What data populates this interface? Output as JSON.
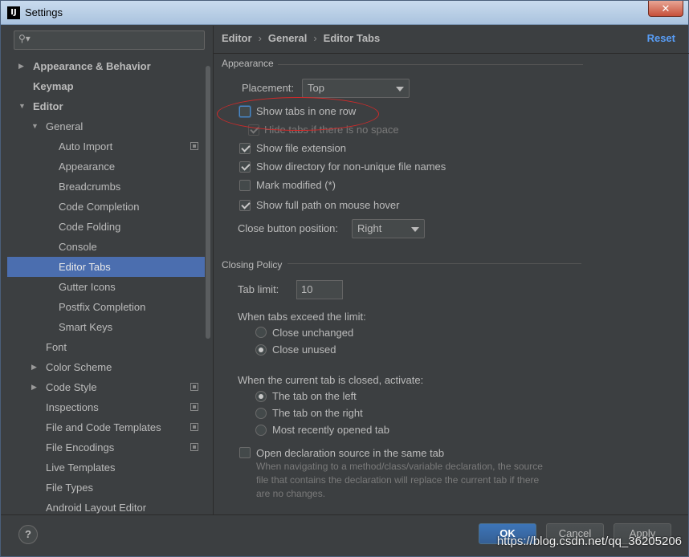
{
  "window": {
    "title": "Settings",
    "close_label": "✕"
  },
  "sidebar": {
    "search": {
      "placeholder": "",
      "icon": "search-icon"
    },
    "items": [
      {
        "label": "Appearance & Behavior",
        "level": 0,
        "bold": true,
        "arrow": "▶"
      },
      {
        "label": "Keymap",
        "level": 0,
        "bold": true,
        "arrow": ""
      },
      {
        "label": "Editor",
        "level": 0,
        "bold": true,
        "arrow": "▼"
      },
      {
        "label": "General",
        "level": 1,
        "bold": false,
        "arrow": "▼"
      },
      {
        "label": "Auto Import",
        "level": 2,
        "bold": false,
        "arrow": "",
        "project_icon": true
      },
      {
        "label": "Appearance",
        "level": 2,
        "bold": false,
        "arrow": ""
      },
      {
        "label": "Breadcrumbs",
        "level": 2,
        "bold": false,
        "arrow": ""
      },
      {
        "label": "Code Completion",
        "level": 2,
        "bold": false,
        "arrow": ""
      },
      {
        "label": "Code Folding",
        "level": 2,
        "bold": false,
        "arrow": ""
      },
      {
        "label": "Console",
        "level": 2,
        "bold": false,
        "arrow": ""
      },
      {
        "label": "Editor Tabs",
        "level": 2,
        "bold": false,
        "arrow": "",
        "selected": true
      },
      {
        "label": "Gutter Icons",
        "level": 2,
        "bold": false,
        "arrow": ""
      },
      {
        "label": "Postfix Completion",
        "level": 2,
        "bold": false,
        "arrow": ""
      },
      {
        "label": "Smart Keys",
        "level": 2,
        "bold": false,
        "arrow": ""
      },
      {
        "label": "Font",
        "level": 1,
        "bold": false,
        "arrow": ""
      },
      {
        "label": "Color Scheme",
        "level": 1,
        "bold": false,
        "arrow": "▶"
      },
      {
        "label": "Code Style",
        "level": 1,
        "bold": false,
        "arrow": "▶",
        "project_icon": true
      },
      {
        "label": "Inspections",
        "level": 1,
        "bold": false,
        "arrow": "",
        "project_icon": true
      },
      {
        "label": "File and Code Templates",
        "level": 1,
        "bold": false,
        "arrow": "",
        "project_icon": true
      },
      {
        "label": "File Encodings",
        "level": 1,
        "bold": false,
        "arrow": "",
        "project_icon": true
      },
      {
        "label": "Live Templates",
        "level": 1,
        "bold": false,
        "arrow": ""
      },
      {
        "label": "File Types",
        "level": 1,
        "bold": false,
        "arrow": ""
      },
      {
        "label": "Android Layout Editor",
        "level": 1,
        "bold": false,
        "arrow": ""
      }
    ]
  },
  "breadcrumb": {
    "part1": "Editor",
    "part2": "General",
    "part3": "Editor Tabs",
    "sep": "›"
  },
  "reset_label": "Reset",
  "appearance": {
    "title": "Appearance",
    "placement_label": "Placement:",
    "placement_value": "Top",
    "show_tabs_one_row": {
      "label": "Show tabs in one row",
      "checked": false
    },
    "hide_tabs_no_space": {
      "label": "Hide tabs if there is no space",
      "checked": true
    },
    "show_file_extension": {
      "label": "Show file extension",
      "checked": true
    },
    "show_directory": {
      "label": "Show directory for non-unique file names",
      "checked": true
    },
    "mark_modified": {
      "label": "Mark modified (*)",
      "checked": false
    },
    "show_full_path": {
      "label": "Show full path on mouse hover",
      "checked": true
    },
    "close_button_label": "Close button position:",
    "close_button_value": "Right"
  },
  "closing_policy": {
    "title": "Closing Policy",
    "tab_limit_label": "Tab limit:",
    "tab_limit_value": "10",
    "exceed_label": "When tabs exceed the limit:",
    "close_unchanged": "Close unchanged",
    "close_unused": "Close unused",
    "activate_label": "When the current tab is closed, activate:",
    "tab_left": "The tab on the left",
    "tab_right": "The tab on the right",
    "most_recent": "Most recently opened tab",
    "open_decl": {
      "label": "Open declaration source in the same tab",
      "checked": false
    },
    "open_decl_desc_1": "When navigating to a method/class/variable declaration, the source",
    "open_decl_desc_2": "file that contains the declaration will replace the current tab if there",
    "open_decl_desc_3": "are no changes."
  },
  "buttons": {
    "help": "?",
    "ok": "OK",
    "cancel": "Cancel",
    "apply": "Apply"
  },
  "watermark": "https://blog.csdn.net/qq_36205206",
  "colors": {
    "selection": "#4b6eaf",
    "link": "#589df6",
    "annotation": "#d02a2a",
    "primary_button": "#365f94"
  }
}
